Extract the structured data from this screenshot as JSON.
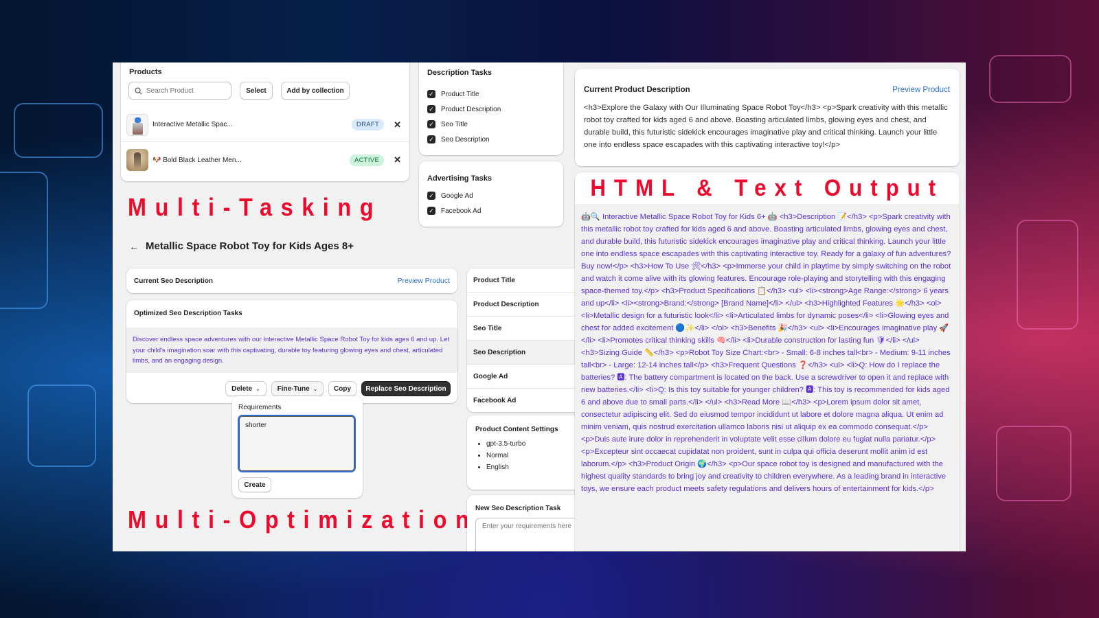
{
  "products": {
    "title": "Products",
    "search_placeholder": "Search Product",
    "select_label": "Select",
    "add_by_collection_label": "Add by collection",
    "items": [
      {
        "name": "Interactive Metallic Spac...",
        "status": "DRAFT"
      },
      {
        "name": "🐶 Bold Black Leather Men...",
        "status": "ACTIVE"
      }
    ],
    "remove_symbol": "✕"
  },
  "description_tasks": {
    "title": "Description Tasks",
    "items": [
      {
        "label": "Product Title",
        "checked": true
      },
      {
        "label": "Product Description",
        "checked": true
      },
      {
        "label": "Seo Title",
        "checked": true
      },
      {
        "label": "Seo Description",
        "checked": true
      }
    ]
  },
  "advertising_tasks": {
    "title": "Advertising Tasks",
    "items": [
      {
        "label": "Google Ad",
        "checked": true
      },
      {
        "label": "Facebook Ad",
        "checked": true
      }
    ]
  },
  "overlays": {
    "multi_tasking": "Multi-Tasking",
    "multi_optimization": "Multi-Optimization",
    "html_text_output": "HTML & Text Output"
  },
  "page": {
    "back_symbol": "←",
    "title": "Metallic Space Robot Toy for Kids Ages 8+"
  },
  "current_seo": {
    "title": "Current Seo Description",
    "preview_link": "Preview Product"
  },
  "optimized_seo": {
    "title": "Optimized Seo Description Tasks",
    "body": "Discover endless space adventures with our Interactive Metallic Space Robot Toy for kids ages 6 and up. Let your child's imagination soar with this captivating, durable toy featuring glowing eyes and chest, articulated limbs, and an engaging design.",
    "delete_label": "Delete",
    "fine_tune_label": "Fine-Tune",
    "copy_label": "Copy",
    "replace_label": "Replace Seo Description",
    "chevron": "⌄"
  },
  "fine_tune_popover": {
    "label": "Requirements",
    "value": "shorter",
    "create_label": "Create"
  },
  "task_nav": {
    "items": [
      "Product Title",
      "Product Description",
      "Seo Title",
      "Seo Description",
      "Google Ad",
      "Facebook Ad"
    ],
    "selected": "Seo Description"
  },
  "content_settings": {
    "title": "Product Content Settings",
    "items": [
      "gpt-3.5-turbo",
      "Normal",
      "English"
    ]
  },
  "new_task": {
    "title": "New Seo Description Task",
    "placeholder": "Enter your requirements here"
  },
  "current_product_description": {
    "title": "Current Product Description",
    "preview_link": "Preview Product",
    "body": "<h3>Explore the Galaxy with Our Illuminating Space Robot Toy</h3> <p>Spark creativity with this metallic robot toy crafted for kids aged 6 and above. Boasting articulated limbs, glowing eyes and chest, and durable build, this futuristic sidekick encourages imaginative play and critical thinking. Launch your little one into endless space escapades with this captivating interactive toy!</p>"
  },
  "output": {
    "body": "🤖🔍 Interactive Metallic Space Robot Toy for Kids 6+ 🤖 <h3>Description 📝</h3> <p>Spark creativity with this metallic robot toy crafted for kids aged 6 and above. Boasting articulated limbs, glowing eyes and chest, and durable build, this futuristic sidekick encourages imaginative play and critical thinking. Launch your little one into endless space escapades with this captivating interactive toy. Ready for a galaxy of fun adventures? Buy now!</p> <h3>How To Use 🛠</h3> <p>Immerse your child in playtime by simply switching on the robot and watch it come alive with its glowing features. Encourage role-playing and storytelling with this engaging space-themed toy.</p> <h3>Product Specifications 📋</h3> <ul> <li><strong>Age Range:</strong> 6 years and up</li> <li><strong>Brand:</strong> [Brand Name]</li> </ul> <h3>Highlighted Features 🌟</h3> <ol> <li>Metallic design for a futuristic look</li> <li>Articulated limbs for dynamic poses</li> <li>Glowing eyes and chest for added excitement 🔵✨</li> </ol> <h3>Benefits 🎉</h3> <ul> <li>Encourages imaginative play 🚀</li> <li>Promotes critical thinking skills 🧠</li> <li>Durable construction for lasting fun 🛡</li> </ul> <h3>Sizing Guide 📏</h3> <p>Robot Toy Size Chart:<br> - Small: 6-8 inches tall<br> - Medium: 9-11 inches tall<br> - Large: 12-14 inches tall</p> <h3>Frequent Questions ❓</h3> <ul> <li>Q: How do I replace the batteries? 🅰: The battery compartment is located on the back. Use a screwdriver to open it and replace with new batteries.</li> <li>Q: Is this toy suitable for younger children? 🅰: This toy is recommended for kids aged 6 and above due to small parts.</li> </ul> <h3>Read More 📖</h3> <p>Lorem ipsum dolor sit amet, consectetur adipiscing elit. Sed do eiusmod tempor incididunt ut labore et dolore magna aliqua. Ut enim ad minim veniam, quis nostrud exercitation ullamco laboris nisi ut aliquip ex ea commodo consequat.</p> <p>Duis aute irure dolor in reprehenderit in voluptate velit esse cillum dolore eu fugiat nulla pariatur.</p> <p>Excepteur sint occaecat cupidatat non proident, sunt in culpa qui officia deserunt mollit anim id est laborum.</p> <h3>Product Origin 🌍</h3> <p>Our space robot toy is designed and manufactured with the highest quality standards to bring joy and creativity to children everywhere. As a leading brand in interactive toys, we ensure each product meets safety regulations and delivers hours of entertainment for kids.</p>"
  },
  "colors": {
    "accent_link": "#2c6ecb",
    "output_text": "#5a2fd3",
    "overlay_red": "#ee0a2c",
    "draft_badge": "#dbeafa",
    "active_badge": "#cdf3dc",
    "primary_button": "#303030"
  }
}
